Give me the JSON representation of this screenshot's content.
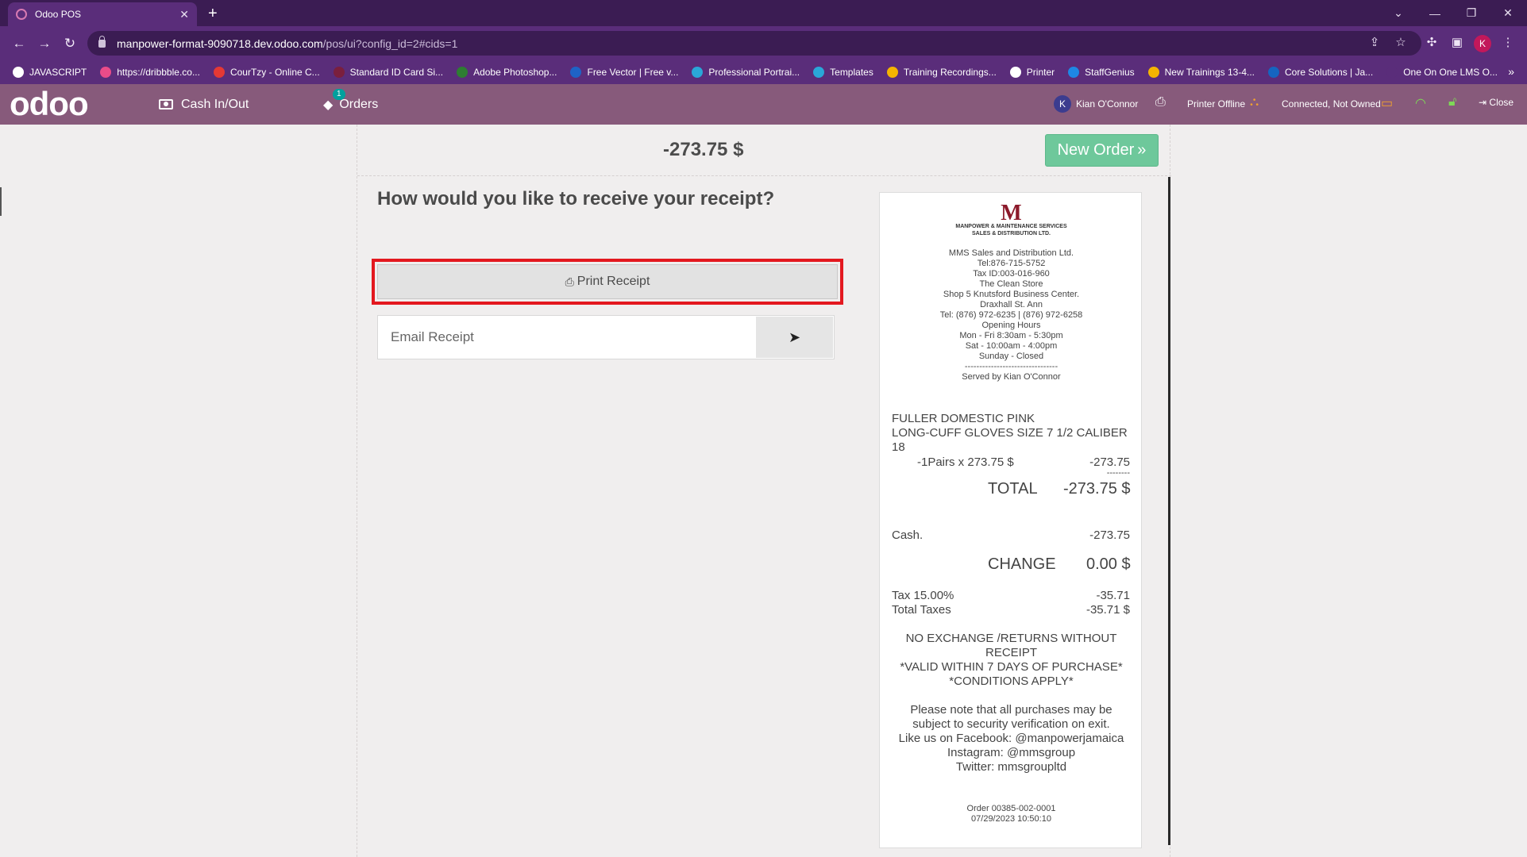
{
  "browser": {
    "tab_title": "Odoo POS",
    "url_host": "manpower-format-9090718.dev.odoo.com",
    "url_path": "/pos/ui?config_id=2#cids=1",
    "profile_initial": "K",
    "bookmarks": [
      "JAVASCRIPT",
      "https://dribbble.co...",
      "CourTzy - Online C...",
      "Standard ID Card Si...",
      "Adobe Photoshop...",
      "Free Vector | Free v...",
      "Professional Portrai...",
      "Templates",
      "Training Recordings...",
      "Printer",
      "StaffGenius",
      "New Trainings 13-4...",
      "Core Solutions | Ja...",
      "One On One LMS O..."
    ],
    "bookmark_colors": [
      "#ffffff",
      "#ea4c89",
      "#e53935",
      "#7a1f3d",
      "#2e7d32",
      "#1e63c6",
      "#2aa7d8",
      "#2aa7d8",
      "#f4b400",
      "#ffffff",
      "#1e88e5",
      "#f4b400",
      "#1565c0",
      "#5a2d7a"
    ]
  },
  "pos": {
    "logo": "odoo",
    "cash_label": "Cash In/Out",
    "orders_label": "Orders",
    "orders_badge": "1",
    "user_initial": "K",
    "user_name": "Kian O'Connor",
    "printer_status": "Printer Offline",
    "connection_status": "Connected, Not Owned",
    "close_label": "Close",
    "accent_color": "#875a7b"
  },
  "screen": {
    "amount": "-273.75 $",
    "new_order_label": "New Order",
    "question": "How would you like to receive your receipt?",
    "print_label": "Print Receipt",
    "email_placeholder": "Email Receipt"
  },
  "receipt": {
    "company_short": "MANPOWER & MAINTENANCE SERVICES",
    "company_sub": "SALES & DISTRIBUTION LTD.",
    "header_lines": [
      "MMS Sales and Distribution Ltd.",
      "Tel:876-715-5752",
      "Tax ID:003-016-960",
      "The Clean Store",
      "Shop 5 Knutsford Business Center.",
      "Draxhall St. Ann",
      "Tel: (876) 972-6235 | (876) 972-6258",
      "Opening Hours",
      "Mon - Fri 8:30am - 5:30pm",
      "Sat - 10:00am - 4:00pm",
      "Sunday - Closed",
      "--------------------------------",
      "Served by Kian O'Connor"
    ],
    "product_lines": [
      "FULLER DOMESTIC PINK",
      "LONG-CUFF GLOVES SIZE 7 1/2 CALIBER",
      "18"
    ],
    "qty_line": "-1Pairs x 273.75 $",
    "qty_amount": "-273.75",
    "dashes": "--------",
    "total_label": "TOTAL",
    "total_value": "-273.75 $",
    "payment_label": "Cash.",
    "payment_value": "-273.75",
    "change_label": "CHANGE",
    "change_value": "0.00 $",
    "tax_label": "Tax 15.00%",
    "tax_value": "-35.71",
    "total_taxes_label": "Total Taxes",
    "total_taxes_value": "-35.71 $",
    "policy_lines": [
      "NO EXCHANGE /RETURNS WITHOUT",
      "RECEIPT",
      "*VALID WITHIN 7 DAYS OF PURCHASE*",
      "*CONDITIONS APPLY*"
    ],
    "note_lines": [
      "Please note that all purchases may be",
      "subject to security verification on exit.",
      "Like us on Facebook: @manpowerjamaica",
      "Instagram: @mmsgroup",
      "Twitter: mmsgroupltd"
    ],
    "order_ref": "Order 00385-002-0001",
    "order_date": "07/29/2023 10:50:10"
  }
}
